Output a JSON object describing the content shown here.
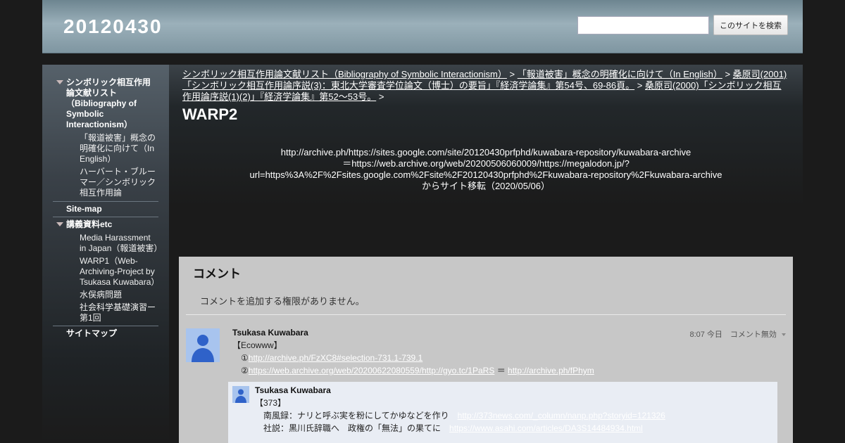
{
  "header": {
    "site_title": "20120430",
    "search_placeholder": "",
    "search_button": "このサイトを検索"
  },
  "sidebar": {
    "items": [
      {
        "label": "シンボリック相互作用論文献リスト（Bibliography of Symbolic Interactionism）",
        "level": 0,
        "expanded": true
      },
      {
        "label": "「報道被害」概念の明確化に向けて（In English）",
        "level": 1
      },
      {
        "label": "ハーバート・ブルーマー／シンボリック相互作用論",
        "level": 1
      },
      {
        "label": "Site-map",
        "level": 0
      },
      {
        "label": "講義資料etc",
        "level": 0,
        "expanded": true
      },
      {
        "label": "Media Harassment in Japan（報道被害）",
        "level": 1
      },
      {
        "label": "WARP1（Web-Archiving-Project by Tsukasa Kuwabara）",
        "level": 1
      },
      {
        "label": "水俣病問題",
        "level": 1
      },
      {
        "label": "社会科学基礎演習ー第1回",
        "level": 1
      },
      {
        "label": "サイトマップ",
        "level": 0
      }
    ]
  },
  "breadcrumb": {
    "links": [
      "シンボリック相互作用論文献リスト（Bibliography of Symbolic Interactionism）",
      "「報道被害」概念の明確化に向けて（In English）",
      "桑原司(2001)「シンボリック相互作用論序説(3)：東北大学審査学位論文（博士）の要旨」『経済学論集』第54号、69-86頁。",
      "桑原司(2000)「シンボリック相互作用論序説(1)(2)」『経済学論集』第52～53号。"
    ],
    "separator": ">"
  },
  "page": {
    "title": "WARP2",
    "content_lines": [
      "http://archive.ph/https://sites.google.com/site/20120430prfphd/kuwabara-repository/kuwabara-archive",
      "＝https://web.archive.org/web/20200506060009/https://megalodon.jp/?",
      "url=https%3A%2F%2Fsites.google.com%2Fsite%2F20120430prfphd%2Fkuwabara-repository%2Fkuwabara-archive",
      "からサイト移転（2020/05/06）"
    ]
  },
  "comments": {
    "heading": "コメント",
    "no_permission": "コメントを追加する権限がありません。",
    "items": [
      {
        "author": "Tsukasa Kuwabara",
        "meta": "8:07 今日　コメント無効",
        "lines": [
          {
            "text": "【Ecowww】"
          },
          {
            "prefix": "　①",
            "link": "http://archive.ph/FzXC8#selection-731.1-739.1"
          },
          {
            "prefix": "　②",
            "link": "https://web.archive.org/web/20200622080559/http://gyo.tc/1PaRS",
            "middle": "＝",
            "link2": "http://archive.ph/fPhym"
          }
        ]
      }
    ],
    "reply": {
      "author": "Tsukasa Kuwabara",
      "lines": [
        {
          "text": "【373】"
        },
        {
          "prefix": "　南風録：ナリと呼ぶ実を粉にしてかゆなどを作り　",
          "link": "http://373news.com/_column/nanp.php?storyid=121326"
        },
        {
          "prefix": "　社説：黒川氏辞職へ　政権の「無法」の果てに　",
          "link": "https://www.asahi.com/articles/DA3S14484934.html"
        }
      ]
    }
  }
}
